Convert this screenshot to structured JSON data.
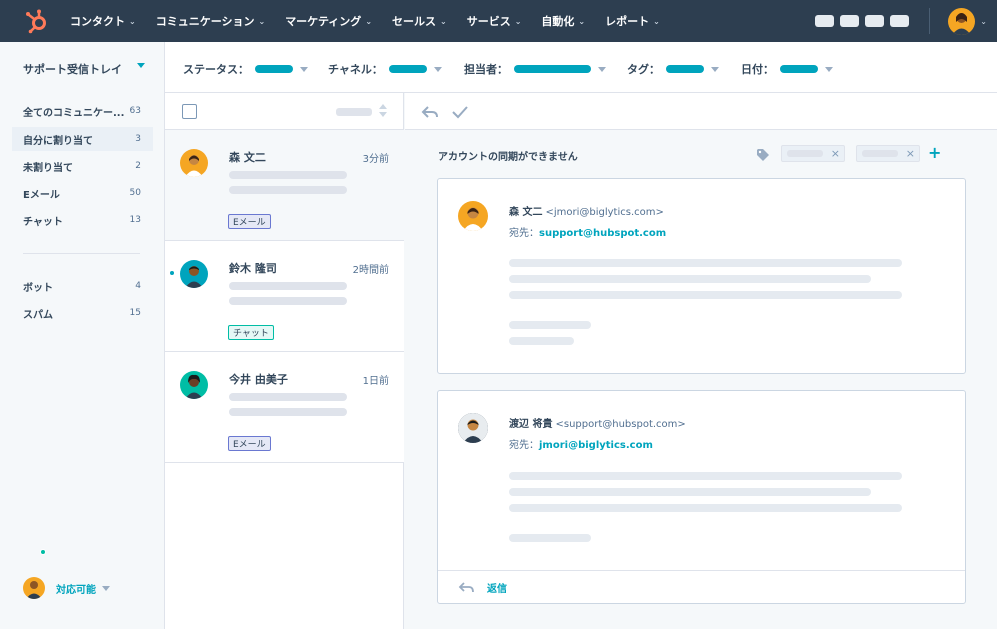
{
  "nav": {
    "items": [
      {
        "label": "コンタクト"
      },
      {
        "label": "コミュニケーション"
      },
      {
        "label": "マーケティング"
      },
      {
        "label": "セールス"
      },
      {
        "label": "サービス"
      },
      {
        "label": "自動化"
      },
      {
        "label": "レポート"
      }
    ]
  },
  "sidebar": {
    "inbox_title": "サポート受信トレイ",
    "items": [
      {
        "label": "全てのコミュニケー...",
        "count": "63"
      },
      {
        "label": "自分に割り当て",
        "count": "3"
      },
      {
        "label": "未割り当て",
        "count": "2"
      },
      {
        "label": "Eメール",
        "count": "50"
      },
      {
        "label": "チャット",
        "count": "13"
      },
      {
        "label": "ボット",
        "count": "4"
      },
      {
        "label": "スパム",
        "count": "15"
      }
    ],
    "status": "対応可能"
  },
  "filters": [
    {
      "label": "ステータス："
    },
    {
      "label": "チャネル："
    },
    {
      "label": "担当者："
    },
    {
      "label": "タグ："
    },
    {
      "label": "日付："
    }
  ],
  "conversations": [
    {
      "name": "森 文二",
      "time": "3分前",
      "tag": "Eメール"
    },
    {
      "name": "鈴木 隆司",
      "time": "2時間前",
      "tag": "チャット"
    },
    {
      "name": "今井 由美子",
      "time": "1日前",
      "tag": "Eメール"
    }
  ],
  "thread": {
    "subject": "アカウントの同期ができません",
    "messages": [
      {
        "from_name": "森 文二",
        "from_addr": "<jmori@biglytics.com>",
        "to_label": "宛先：",
        "to_addr": "support@hubspot.com"
      },
      {
        "from_name": "渡辺 将貴",
        "from_addr": "<support@hubspot.com>",
        "to_label": "宛先：",
        "to_addr": "jmori@biglytics.com"
      }
    ],
    "reply_label": "返信"
  },
  "colors": {
    "nav_bg": "#2d3e50",
    "accent": "#00a4bd",
    "logo": "#ff7a59"
  },
  "icons": [
    "hubspot-logo-icon",
    "chevron-down-icon",
    "reply-icon",
    "check-icon",
    "tag-icon",
    "close-icon",
    "plus-icon",
    "sort-icon"
  ]
}
